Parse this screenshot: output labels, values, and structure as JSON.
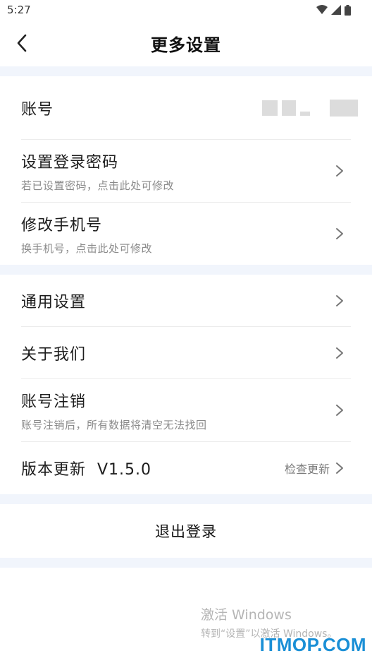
{
  "status_bar": {
    "time": "5:27"
  },
  "header": {
    "title": "更多设置"
  },
  "section1": {
    "account_label": "账号",
    "password": {
      "title": "设置登录密码",
      "subtitle": "若已设置密码，点击此处可修改"
    },
    "phone": {
      "title": "修改手机号",
      "subtitle": "换手机号，点击此处可修改"
    }
  },
  "section2": {
    "general": {
      "title": "通用设置"
    },
    "about": {
      "title": "关于我们"
    },
    "cancel_account": {
      "title": "账号注销",
      "subtitle": "账号注销后，所有数据将清空无法找回"
    },
    "version": {
      "title": "版本更新  V1.5.0",
      "action": "检查更新"
    }
  },
  "logout_label": "退出登录",
  "watermark": {
    "line1": "激活 Windows",
    "line2": "转到“设置”以激活 Windows。"
  },
  "brand_watermark": "ITMOP.COM",
  "colors": {
    "section_gap": "#f1f5fc",
    "brand": "#1a8fd6"
  }
}
